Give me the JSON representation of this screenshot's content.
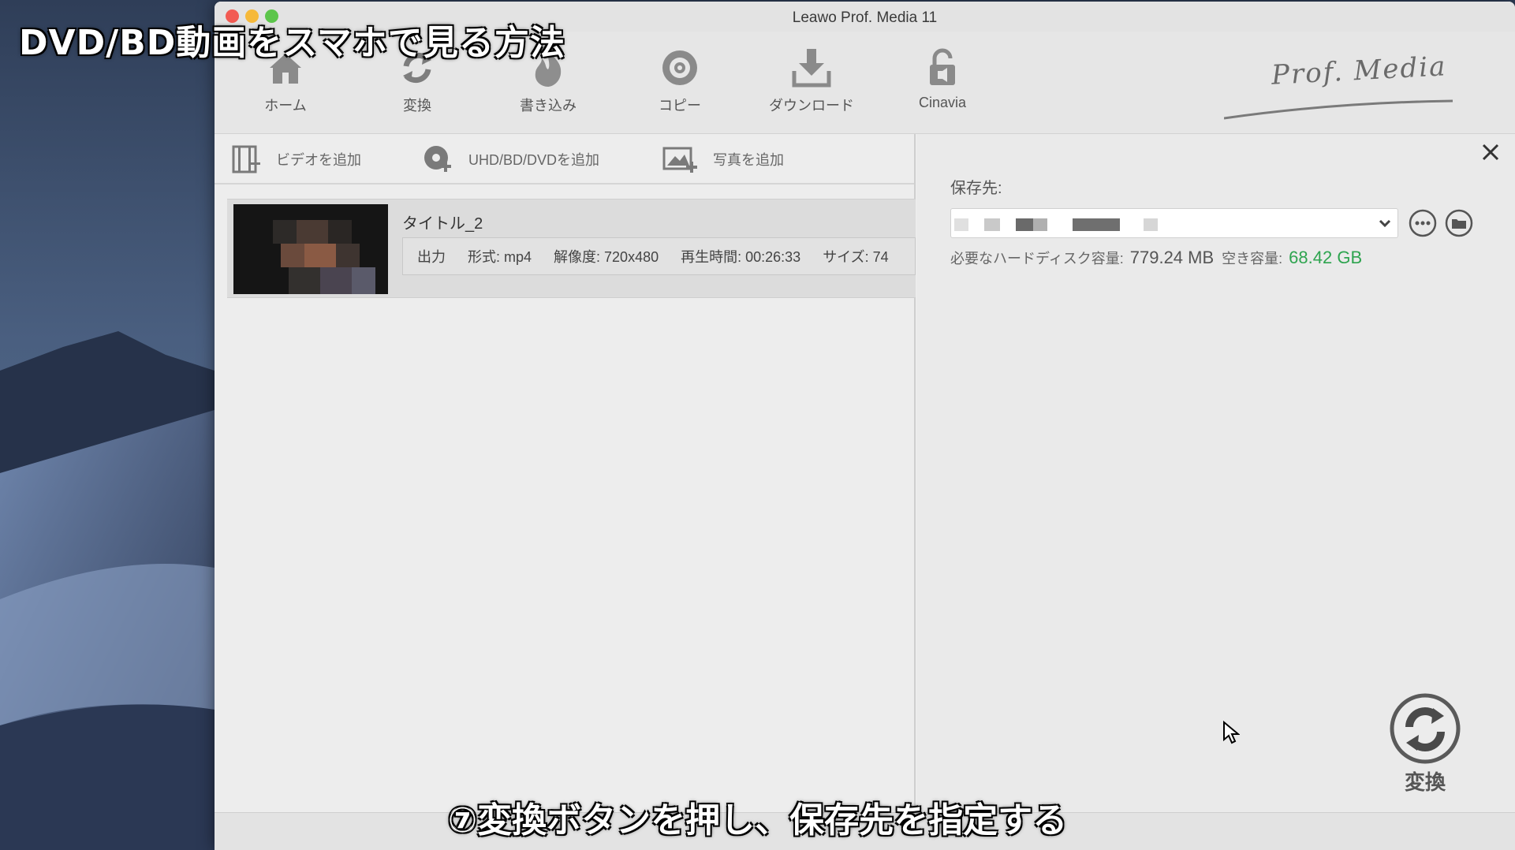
{
  "overlay": {
    "title": "DVD/BD動画をスマホで見る方法",
    "subtitle": "⑦変換ボタンを押し、保存先を指定する"
  },
  "window": {
    "title": "Leawo Prof. Media 11"
  },
  "toolbar": {
    "items": [
      {
        "label": "ホーム",
        "icon": "home-icon"
      },
      {
        "label": "変換",
        "icon": "convert-icon"
      },
      {
        "label": "書き込み",
        "icon": "burn-icon"
      },
      {
        "label": "コピー",
        "icon": "copy-icon"
      },
      {
        "label": "ダウンロード",
        "icon": "download-icon"
      },
      {
        "label": "Cinavia",
        "icon": "cinavia-icon"
      }
    ],
    "brand": "Prof. Media"
  },
  "actions": {
    "add_video": "ビデオを追加",
    "add_disc": "UHD/BD/DVDを追加",
    "add_photo": "写真を追加"
  },
  "item": {
    "title": "タイトル_2",
    "output_label": "出力",
    "format": "形式: mp4",
    "resolution": "解像度: 720x480",
    "duration": "再生時間: 00:26:33",
    "size": "サイズ: 74"
  },
  "settings": {
    "save_label": "保存先:",
    "disk_required_label": "必要なハードディスク容量:",
    "disk_required_value": "779.24 MB",
    "free_space_label": "空き容量:",
    "free_space_value": "68.42 GB",
    "free_space_color": "#2ea44f"
  },
  "convert": {
    "label": "変換"
  }
}
